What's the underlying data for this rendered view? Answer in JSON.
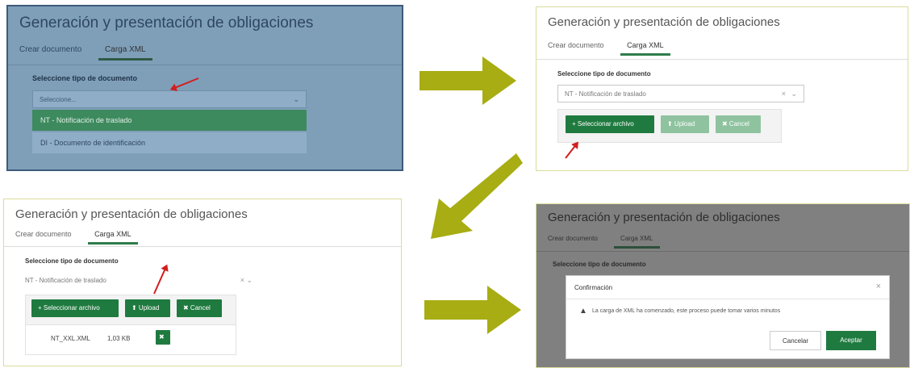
{
  "panel_title": "Generación y presentación de obligaciones",
  "tabs": {
    "create": "Crear documento",
    "xml": "Carga XML"
  },
  "section_label": "Seleccione tipo de documento",
  "select": {
    "placeholder": "Seleccione...",
    "value": "NT - Notificación de traslado",
    "clear_icon": "×",
    "chevron_icon": "⌄"
  },
  "dropdown_options": [
    "NT - Notificación de traslado",
    "DI - Documento de identificación"
  ],
  "buttons": {
    "select_files": "+ Seleccionar archivo",
    "upload": "⬆ Upload",
    "cancel": "✖ Cancel"
  },
  "file": {
    "name": "NT_XXL.XML",
    "size": "1,03 KB",
    "remove_icon": "✖"
  },
  "dialog": {
    "title": "Confirmación",
    "close_icon": "×",
    "message": "La carga de XML ha comenzado, este proceso puede tomar varios minutos",
    "warning_icon": "▲",
    "cancel": "Cancelar",
    "accept": "Aceptar"
  },
  "colors": {
    "brand_green": "#1f7a3f",
    "arrow_olive": "#a7ad12",
    "pointer_red": "#d21e1e",
    "overlay": "#808080"
  }
}
